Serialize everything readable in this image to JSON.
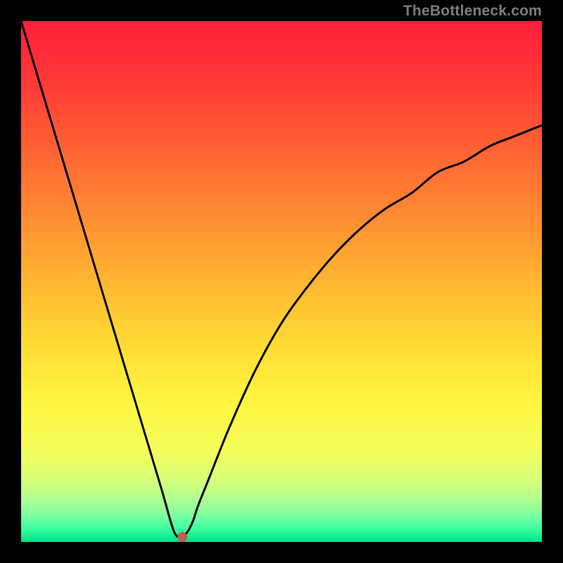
{
  "watermark": "TheBottleneck.com",
  "chart_data": {
    "type": "line",
    "title": "",
    "xlabel": "",
    "ylabel": "",
    "xlim": [
      0,
      100
    ],
    "ylim": [
      0,
      100
    ],
    "series": [
      {
        "name": "curve",
        "x": [
          0,
          3,
          6,
          9,
          12,
          15,
          18,
          21,
          24,
          27,
          29,
          30,
          31,
          32,
          33,
          34,
          36,
          40,
          45,
          50,
          55,
          60,
          65,
          70,
          75,
          80,
          85,
          90,
          95,
          100
        ],
        "values": [
          100,
          90,
          80,
          70,
          60,
          50,
          40,
          30,
          20,
          10,
          3,
          1,
          1,
          2,
          4,
          7,
          12,
          22,
          33,
          42,
          49,
          55,
          60,
          64,
          67,
          71,
          73,
          76,
          78,
          80
        ]
      }
    ],
    "marker": {
      "x": 31,
      "y": 1,
      "color": "#c85a4e"
    },
    "gradient_stops": [
      {
        "t": 0.0,
        "color": "#ff1f3a"
      },
      {
        "t": 0.12,
        "color": "#ff3a36"
      },
      {
        "t": 0.25,
        "color": "#ff6433"
      },
      {
        "t": 0.38,
        "color": "#ff8e32"
      },
      {
        "t": 0.5,
        "color": "#ffb631"
      },
      {
        "t": 0.62,
        "color": "#ffdb34"
      },
      {
        "t": 0.74,
        "color": "#fff642"
      },
      {
        "t": 0.82,
        "color": "#f6ff5a"
      },
      {
        "t": 0.88,
        "color": "#d8ff78"
      },
      {
        "t": 0.92,
        "color": "#b0ff92"
      },
      {
        "t": 0.95,
        "color": "#7cffa0"
      },
      {
        "t": 0.975,
        "color": "#3effa0"
      },
      {
        "t": 1.0,
        "color": "#00e28a"
      }
    ],
    "curve_color": "#000000",
    "curve_width": 3
  }
}
